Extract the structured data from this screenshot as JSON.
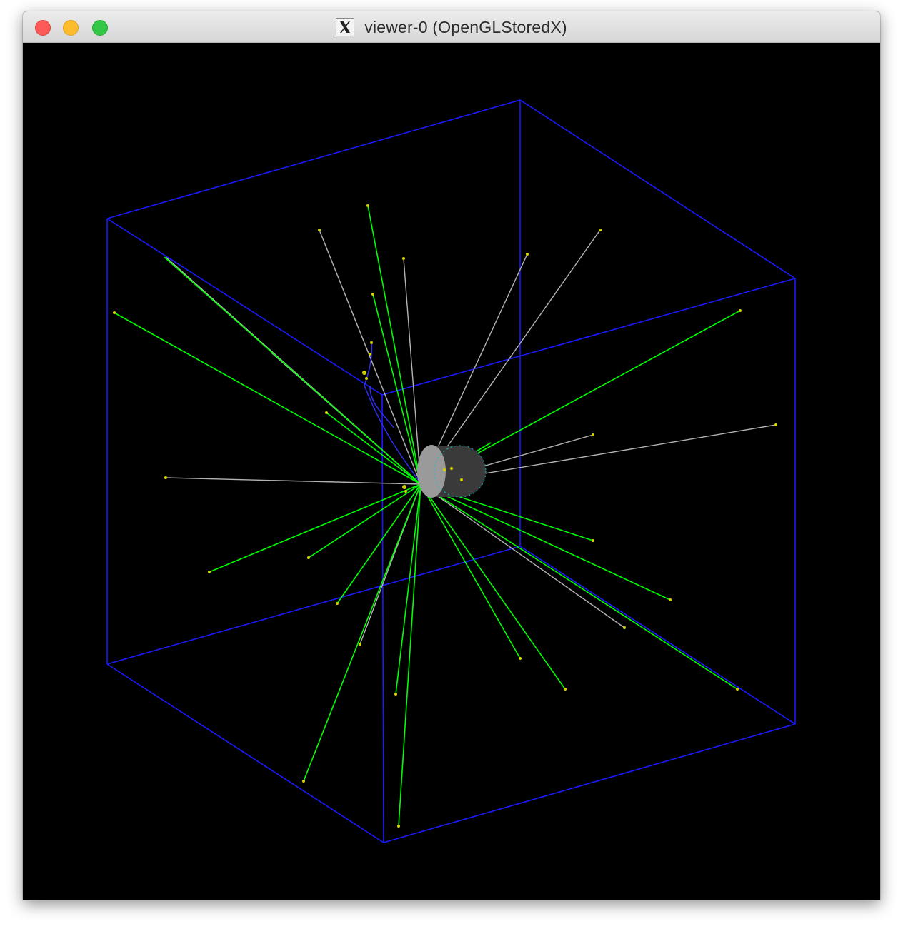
{
  "window": {
    "title": "viewer-0 (OpenGLStoredX)",
    "app_icon": "x11-icon"
  },
  "colors": {
    "background": "#000000",
    "world_box": "#1a1aff",
    "charged_track": "#00ff00",
    "neutral_track": "#b4b4b4",
    "step_point": "#d4d400",
    "detector": "#8a8a8a"
  }
}
